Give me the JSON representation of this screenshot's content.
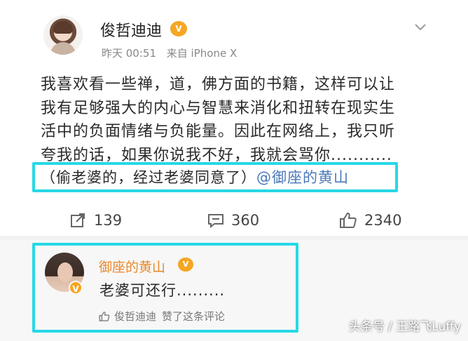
{
  "post": {
    "author": "俊哲迪迪",
    "vip_badge": "V",
    "time": "昨天 00:51",
    "source": "来自 iPhone X",
    "lines": [
      "我喜欢看一些禅，道，佛方面的书籍，这样可以让",
      "我有足够强大的内心与智慧来消化和扭转在现实生",
      "活中的负面情绪与负能量。因此在网络上，我只听",
      "夸我的话，如果你说我不好，我就会骂你..........."
    ],
    "highlight_text": "（偷老婆的，经过老婆同意了）",
    "mention": "@御座的黄山"
  },
  "actions": {
    "repost": "139",
    "comments": "360",
    "likes": "2340"
  },
  "comment": {
    "author": "御座的黄山",
    "vip_badge": "V",
    "verified_badge": "V",
    "text": "老婆可还行.........",
    "liker": "俊哲迪迪",
    "like_note": "赞了这条评论"
  },
  "watermark": "头条号 / 王路飞Luffy",
  "colors": {
    "highlight_border": "#27d8e6",
    "mention": "#4a78b8",
    "comment_name": "#e9892b",
    "vip": "#f5a623"
  },
  "icons": {
    "repost": "repost-icon",
    "comment": "comment-icon",
    "like": "thumbs-up-icon",
    "chevron": "chevron-down-icon"
  }
}
